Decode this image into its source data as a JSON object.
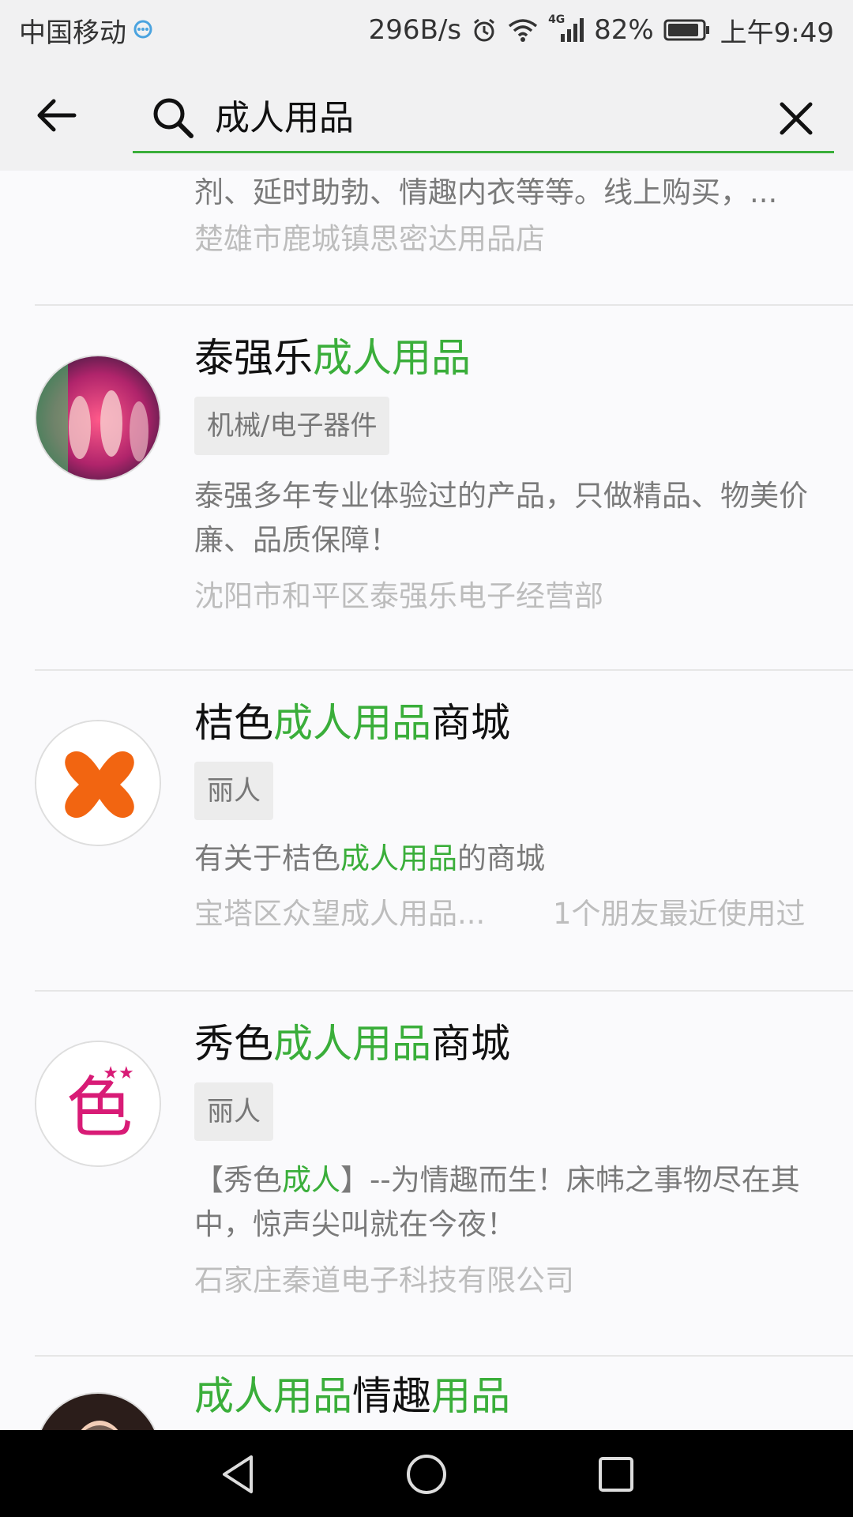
{
  "status_bar": {
    "carrier": "中国移动",
    "speed": "296B/s",
    "network": "4G",
    "battery": "82%",
    "time": "上午9:49"
  },
  "search": {
    "query": "成人用品",
    "back_icon": "back-arrow-icon",
    "search_icon": "search-icon",
    "clear_icon": "close-icon"
  },
  "results": {
    "partial_top": {
      "desc": "剂、延时助勃、情趣内衣等等。线上购买，...",
      "meta": "楚雄市鹿城镇思密达用品店"
    },
    "items": [
      {
        "title_pre": "泰强乐",
        "title_hl": "成人用品",
        "title_post": "",
        "tag": "机械/电子器件",
        "desc": "泰强多年专业体验过的产品，只做精品、物美价廉、品质保障！",
        "meta": "沈阳市和平区泰强乐电子经营部"
      },
      {
        "title_pre": "桔色",
        "title_hl": "成人用品",
        "title_post": "商城",
        "tag": "丽人",
        "desc_pre": "有关于桔色",
        "desc_hl": "成人用品",
        "desc_post": "的商城",
        "meta": "宝塔区众望成人用品...",
        "meta_right": "1个朋友最近使用过"
      },
      {
        "title_pre": "秀色",
        "title_hl": "成人用品",
        "title_post": "商城",
        "tag": "丽人",
        "desc_pre": "【秀色",
        "desc_hl": "成人",
        "desc_post": "】--为情趣而生！床帏之事物尽在其中，惊声尖叫就在今夜！",
        "meta": "石家庄秦道电子科技有限公司"
      },
      {
        "title_hl": "成人用品",
        "title_mid": "情趣",
        "title_hl2": "用品"
      }
    ]
  },
  "nav": {
    "back": "nav-back-icon",
    "home": "nav-home-icon",
    "recents": "nav-recents-icon"
  },
  "colors": {
    "highlight": "#3aae3a",
    "header_bg": "#f1f1f2",
    "nav_bg": "#000000"
  }
}
